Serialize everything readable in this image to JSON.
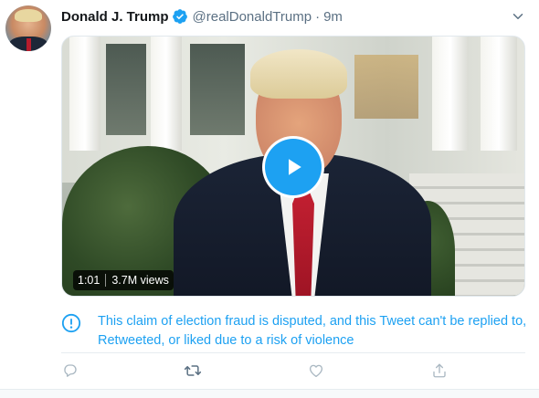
{
  "tweet": {
    "author": {
      "display_name": "Donald J. Trump",
      "handle": "@realDonaldTrump",
      "verified": true
    },
    "separator": "·",
    "timestamp": "9m",
    "media": {
      "type": "video",
      "duration": "1:01",
      "views": "3.7M views"
    },
    "notice": {
      "text": "This claim of election fraud is disputed, and this Tweet can't be replied to, Retweeted, or liked due to a risk of violence"
    },
    "actions": [
      {
        "name": "reply",
        "icon": "reply-icon"
      },
      {
        "name": "retweet",
        "icon": "retweet-icon"
      },
      {
        "name": "like",
        "icon": "heart-icon"
      },
      {
        "name": "share",
        "icon": "share-icon"
      }
    ]
  },
  "colors": {
    "accent": "#1da1f2",
    "secondary_text": "#5b7083",
    "disabled_icon": "#aab8c2",
    "primary_text": "#14171a"
  }
}
